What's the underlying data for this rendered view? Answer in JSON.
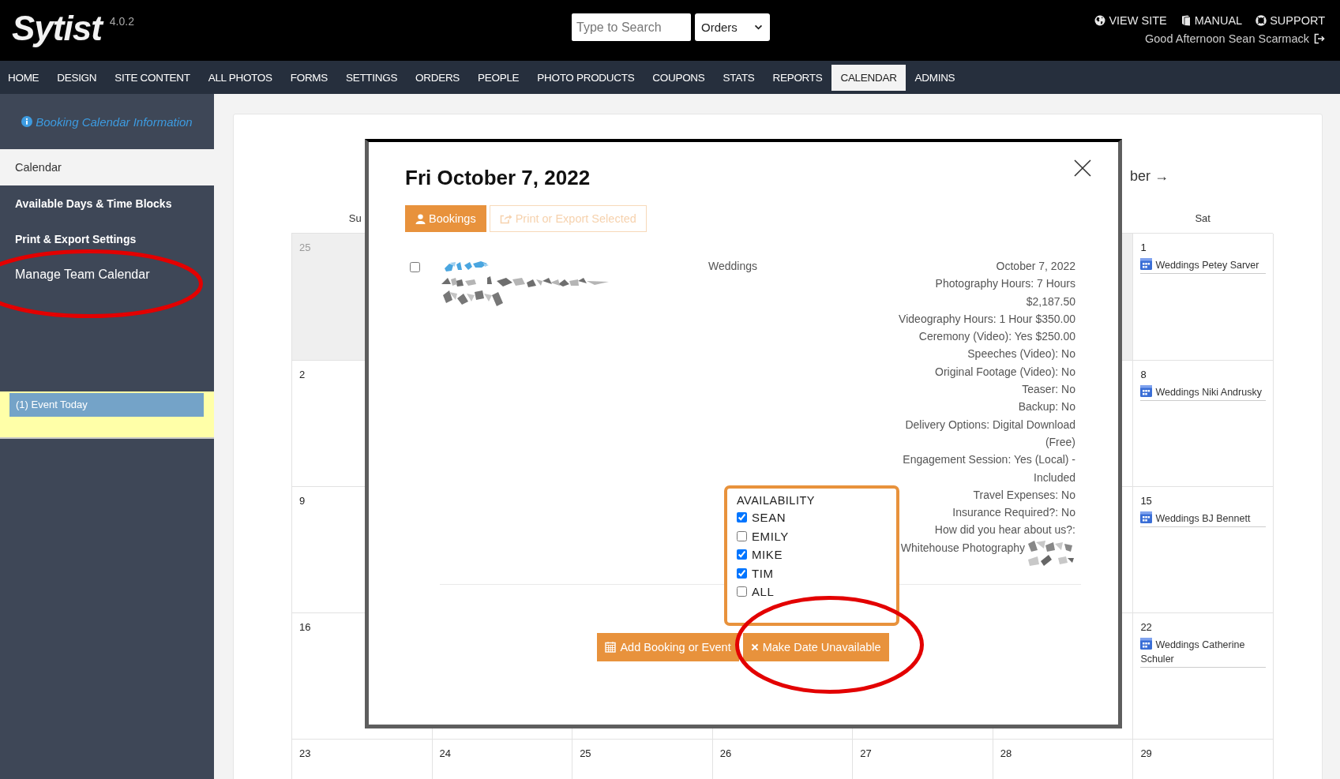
{
  "header": {
    "logo": "Sytist",
    "version": "4.0.2",
    "search": {
      "placeholder": "Type to Search"
    },
    "scope_select": {
      "value": "Orders"
    },
    "links": [
      "VIEW SITE",
      "MANUAL",
      "SUPPORT"
    ],
    "greeting": "Good Afternoon Sean Scarmack"
  },
  "nav": {
    "items": [
      {
        "label": "HOME",
        "selected": false
      },
      {
        "label": "DESIGN",
        "selected": false
      },
      {
        "label": "SITE CONTENT",
        "selected": false
      },
      {
        "label": "ALL PHOTOS",
        "selected": false
      },
      {
        "label": "FORMS",
        "selected": false
      },
      {
        "label": "SETTINGS",
        "selected": false
      },
      {
        "label": "ORDERS",
        "selected": false
      },
      {
        "label": "PEOPLE",
        "selected": false
      },
      {
        "label": "PHOTO PRODUCTS",
        "selected": false
      },
      {
        "label": "COUPONS",
        "selected": false
      },
      {
        "label": "STATS",
        "selected": false
      },
      {
        "label": "REPORTS",
        "selected": false
      },
      {
        "label": "CALENDAR",
        "selected": true
      },
      {
        "label": "ADMINS",
        "selected": false
      }
    ]
  },
  "sidebar": {
    "info_link": "Booking Calendar Information",
    "items": [
      {
        "label": "Calendar",
        "selected": true,
        "kind": "menu"
      },
      {
        "label": "Available Days & Time Blocks",
        "selected": false,
        "kind": "menu"
      },
      {
        "label": "Print & Export Settings",
        "selected": false,
        "kind": "menu"
      },
      {
        "label": "Manage Team Calendar",
        "selected": false,
        "kind": "link"
      }
    ],
    "event_notice": "(1) Event Today"
  },
  "calendar": {
    "next_month": "ber →",
    "weekday_first": "Su",
    "weekday_last": "Sat",
    "weeks": [
      {
        "sunday": {
          "day": "25",
          "other_month": true
        },
        "friday": {
          "other_month": true
        },
        "saturday": {
          "day": "1",
          "other_month": false,
          "events": [
            "Weddings Petey Sarver"
          ]
        }
      },
      {
        "sunday": {
          "day": "2",
          "other_month": false
        },
        "friday": {
          "other_month": false
        },
        "saturday": {
          "day": "8",
          "other_month": false,
          "events": [
            "Weddings Niki Andrusky"
          ]
        }
      },
      {
        "sunday": {
          "day": "9",
          "other_month": false
        },
        "friday": {
          "other_month": false
        },
        "saturday": {
          "day": "15",
          "other_month": false,
          "events": [
            "Weddings BJ Bennett"
          ]
        }
      },
      {
        "sunday": {
          "day": "16",
          "other_month": false
        },
        "friday": {
          "other_month": false
        },
        "saturday": {
          "day": "22",
          "other_month": false,
          "events": [
            "Weddings Catherine Schuler"
          ]
        }
      }
    ],
    "last_week": [
      {
        "day": "23",
        "other_month": false
      },
      {
        "day": "24",
        "other_month": false
      },
      {
        "day": "25",
        "other_month": false
      },
      {
        "day": "26",
        "other_month": false
      },
      {
        "day": "27",
        "other_month": false
      },
      {
        "day": "28",
        "other_month": false
      },
      {
        "day": "29",
        "other_month": false
      }
    ]
  },
  "modal": {
    "title": "Fri October 7, 2022",
    "buttons": [
      {
        "label": "Bookings",
        "disabled": false
      },
      {
        "label": "Print or Export Selected",
        "disabled": true
      }
    ],
    "booking": {
      "checked": false,
      "category": "Weddings",
      "details": [
        "October 7, 2022",
        "Photography Hours: 7 Hours $2,187.50",
        "Videography Hours: 1 Hour $350.00",
        "Ceremony (Video): Yes $250.00",
        "Speeches (Video): No",
        "Original Footage (Video): No",
        "Teaser: No",
        "Backup: No",
        "Delivery Options: Digital Download (Free)",
        "Engagement Session: Yes (Local) - Included",
        "Travel Expenses: No",
        "Insurance Required?: No",
        "How did you hear about us?:"
      ],
      "referral": "Whitehouse Photography"
    },
    "availability": {
      "title": "AVAILABILITY",
      "members": [
        {
          "name": "SEAN",
          "checked": true
        },
        {
          "name": "EMILY",
          "checked": false
        },
        {
          "name": "MIKE",
          "checked": true
        },
        {
          "name": "TIM",
          "checked": true
        },
        {
          "name": "ALL",
          "checked": false
        }
      ]
    },
    "actions": [
      "Add Booking or Event",
      "Make Date Unavailable"
    ]
  }
}
